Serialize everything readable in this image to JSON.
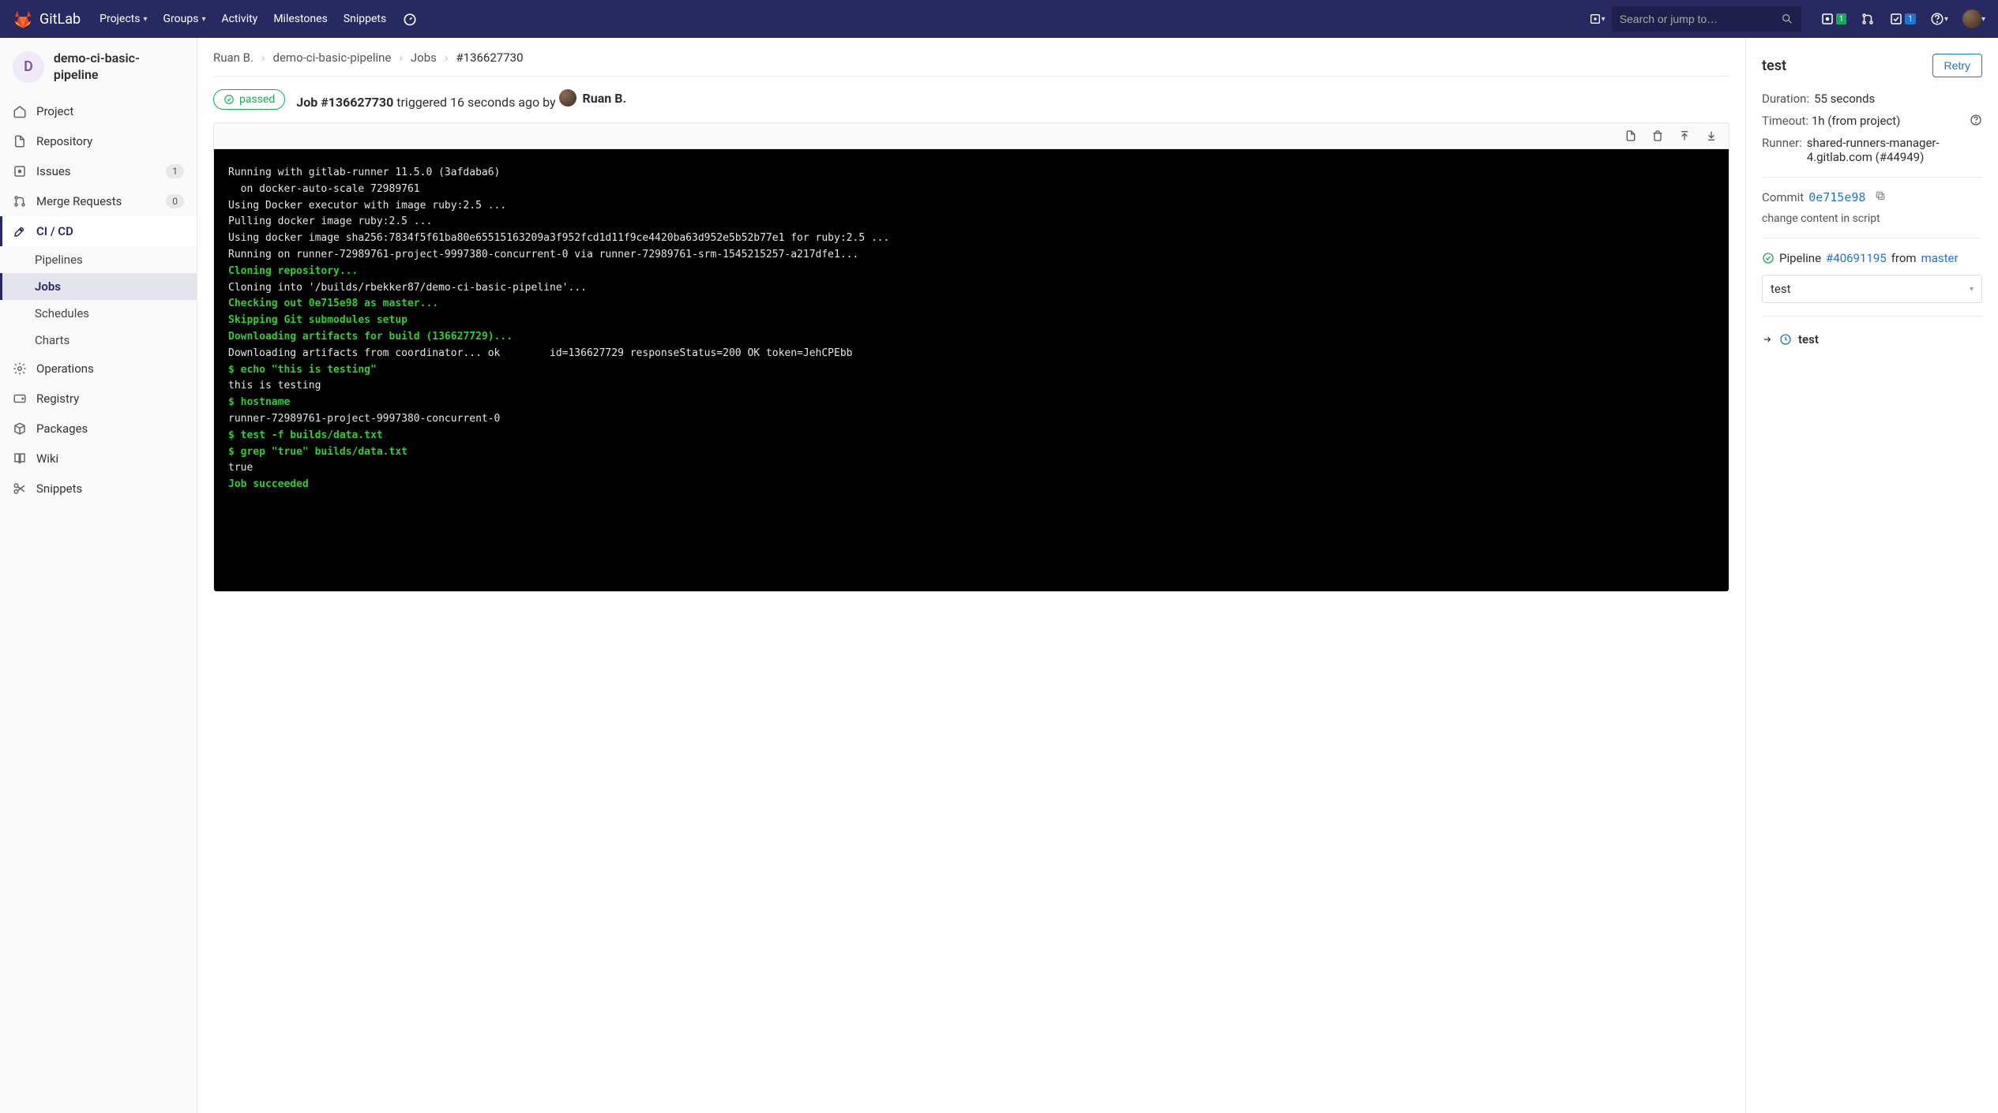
{
  "topbar": {
    "brand": "GitLab",
    "nav": [
      "Projects",
      "Groups",
      "Activity",
      "Milestones",
      "Snippets"
    ],
    "search_placeholder": "Search or jump to…",
    "issues_badge": "1",
    "todos_badge": "1"
  },
  "sidebar": {
    "project_letter": "D",
    "project_name": "demo-ci-basic-pipeline",
    "items": [
      {
        "label": "Project"
      },
      {
        "label": "Repository"
      },
      {
        "label": "Issues",
        "badge": "1"
      },
      {
        "label": "Merge Requests",
        "badge": "0"
      },
      {
        "label": "CI / CD"
      },
      {
        "label": "Operations"
      },
      {
        "label": "Registry"
      },
      {
        "label": "Packages"
      },
      {
        "label": "Wiki"
      },
      {
        "label": "Snippets"
      }
    ],
    "cicd_sub": [
      "Pipelines",
      "Jobs",
      "Schedules",
      "Charts"
    ]
  },
  "breadcrumb": {
    "owner": "Ruan B.",
    "project": "demo-ci-basic-pipeline",
    "section": "Jobs",
    "current": "#136627730"
  },
  "job": {
    "status": "passed",
    "id_label": "Job #136627730",
    "trigger_text": "triggered 16 seconds ago by",
    "user": "Ruan B."
  },
  "log_lines": [
    {
      "t": "Running with gitlab-runner 11.5.0 (3afdaba6)"
    },
    {
      "t": "  on docker-auto-scale 72989761"
    },
    {
      "t": "Using Docker executor with image ruby:2.5 ..."
    },
    {
      "t": "Pulling docker image ruby:2.5 ..."
    },
    {
      "t": "Using docker image sha256:7834f5f61ba80e65515163209a3f952fcd1d11f9ce4420ba63d952e5b52b77e1 for ruby:2.5 ..."
    },
    {
      "t": "Running on runner-72989761-project-9997380-concurrent-0 via runner-72989761-srm-1545215257-a217dfe1..."
    },
    {
      "t": "Cloning repository...",
      "c": "gb"
    },
    {
      "t": "Cloning into '/builds/rbekker87/demo-ci-basic-pipeline'..."
    },
    {
      "t": "Checking out 0e715e98 as master...",
      "c": "gb"
    },
    {
      "t": "Skipping Git submodules setup",
      "c": "gb"
    },
    {
      "t": "Downloading artifacts for build (136627729)...",
      "c": "gb"
    },
    {
      "t": "Downloading artifacts from coordinator... ok        id=136627729 responseStatus=200 OK token=JehCPEbb"
    },
    {
      "t": "$ echo \"this is testing\"",
      "c": "g"
    },
    {
      "t": "this is testing"
    },
    {
      "t": "$ hostname",
      "c": "g"
    },
    {
      "t": "runner-72989761-project-9997380-concurrent-0"
    },
    {
      "t": "$ test -f builds/data.txt",
      "c": "g"
    },
    {
      "t": "$ grep \"true\" builds/data.txt",
      "c": "g"
    },
    {
      "t": "true"
    },
    {
      "t": "Job succeeded",
      "c": "gb"
    }
  ],
  "right": {
    "title": "test",
    "retry": "Retry",
    "duration_label": "Duration:",
    "duration": "55 seconds",
    "timeout_label": "Timeout:",
    "timeout": "1h (from project)",
    "runner_label": "Runner:",
    "runner": "shared-runners-manager-4.gitlab.com (#44949)",
    "commit_label": "Commit",
    "commit_hash": "0e715e98",
    "commit_msg": "change content in script",
    "pipeline_label": "Pipeline",
    "pipeline_id": "#40691195",
    "pipeline_from": "from",
    "pipeline_branch": "master",
    "stage": "test",
    "current_job": "test"
  }
}
